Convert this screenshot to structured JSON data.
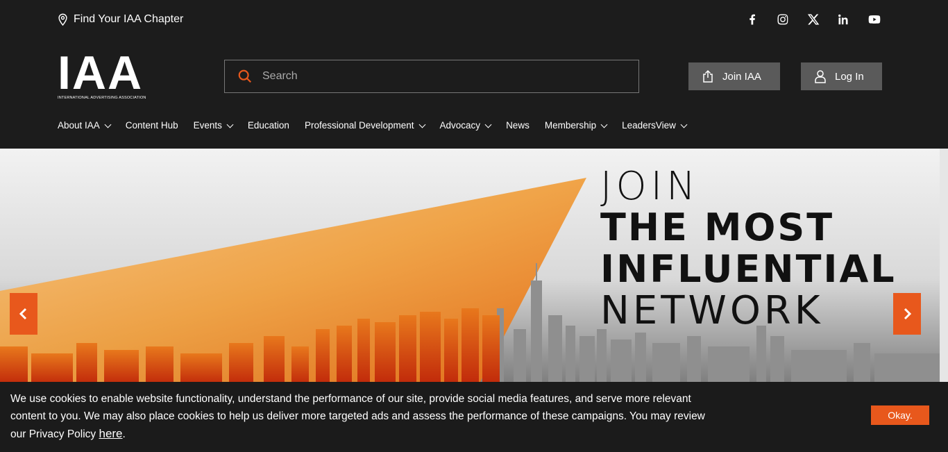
{
  "topbar": {
    "chapter_link": "Find Your IAA Chapter"
  },
  "social": [
    "facebook-icon",
    "instagram-icon",
    "x-icon",
    "linkedin-icon",
    "youtube-icon"
  ],
  "logo": {
    "text": "IAA",
    "subtitle": "INTERNATIONAL ADVERTISING ASSOCIATION"
  },
  "search": {
    "placeholder": "Search"
  },
  "buttons": {
    "join": "Join IAA",
    "login": "Log In"
  },
  "nav": [
    {
      "label": "About IAA",
      "dropdown": true
    },
    {
      "label": "Content Hub",
      "dropdown": false
    },
    {
      "label": "Events",
      "dropdown": true
    },
    {
      "label": "Education",
      "dropdown": false
    },
    {
      "label": "Professional Development",
      "dropdown": true
    },
    {
      "label": "Advocacy",
      "dropdown": true
    },
    {
      "label": "News",
      "dropdown": false
    },
    {
      "label": "Membership",
      "dropdown": true
    },
    {
      "label": "LeadersView",
      "dropdown": true
    }
  ],
  "hero": {
    "line1": "JOIN",
    "line2": "THE MOST",
    "line3": "INFLUENTIAL",
    "line4": "NETWORK"
  },
  "cookie": {
    "text": "We use cookies to enable website functionality, understand the performance of our site, provide social media features, and serve more relevant content to you. We may also place cookies to help us deliver more targeted ads and assess the performance of these campaigns. You may review our Privacy Policy ",
    "link": "here",
    "suffix": ".",
    "button": "Okay."
  },
  "colors": {
    "accent": "#e8581c",
    "header_bg": "#1c1c1c",
    "button_gray": "#5a5a5a"
  }
}
